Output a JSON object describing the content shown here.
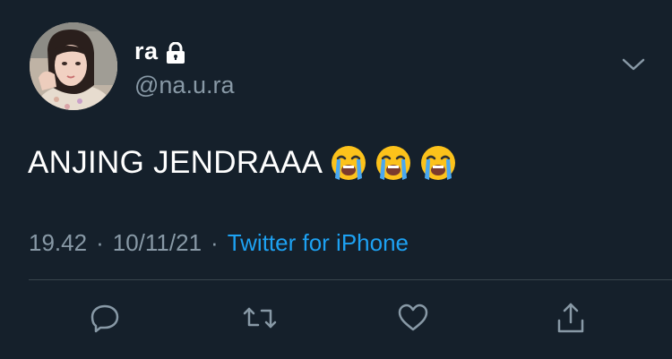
{
  "user": {
    "display_name": "ra",
    "handle": "@na.u.ra",
    "avatar_icon": "profile-photo",
    "protected_icon": "lock-icon"
  },
  "tweet": {
    "text": "ANJING JENDRAAA",
    "emojis": [
      "loudly-crying-face",
      "loudly-crying-face",
      "loudly-crying-face"
    ]
  },
  "meta": {
    "time": "19.42",
    "separator": "·",
    "date": "10/11/21",
    "source": "Twitter for iPhone"
  },
  "actions": [
    "reply-icon",
    "retweet-icon",
    "like-icon",
    "share-icon"
  ],
  "colors": {
    "background": "#15202b",
    "secondary_text": "#8899a6",
    "accent": "#1da1f2",
    "divider": "#38444d"
  }
}
